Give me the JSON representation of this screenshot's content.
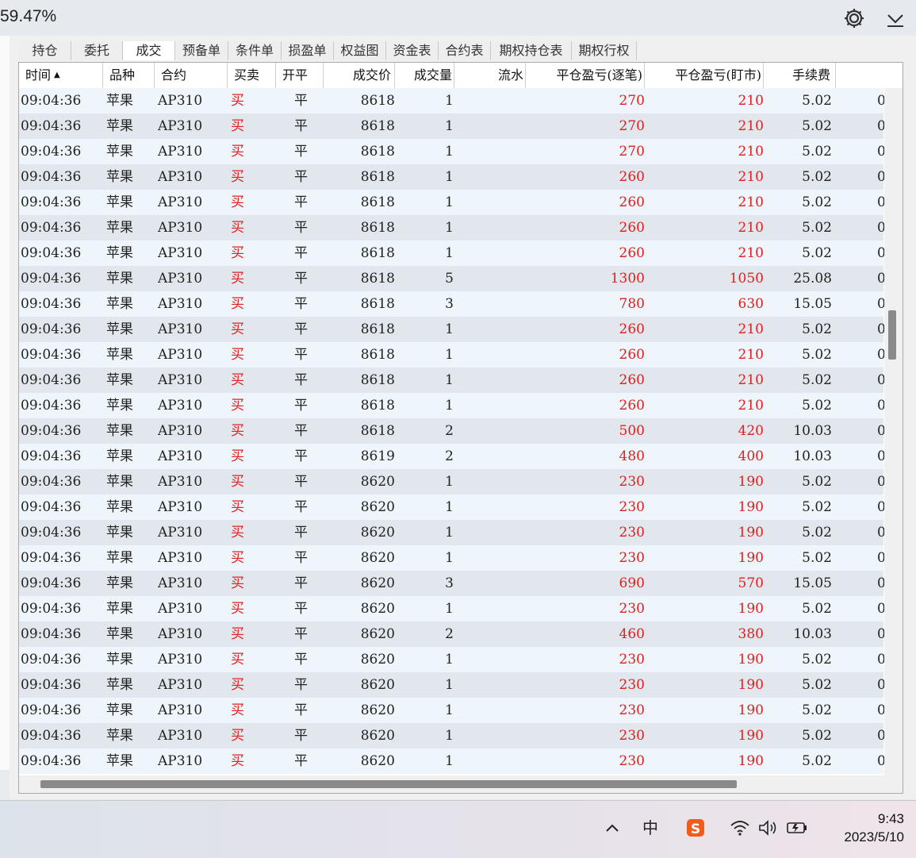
{
  "window": {
    "zoom_label": "59.47%"
  },
  "tabs": [
    "持仓",
    "委托",
    "成交",
    "预备单",
    "条件单",
    "损盈单",
    "权益图",
    "资金表",
    "合约表",
    "期权持仓表",
    "期权行权"
  ],
  "active_tab": "成交",
  "columns": [
    {
      "label": "时间",
      "sort": "▲"
    },
    {
      "label": "品种"
    },
    {
      "label": "合约"
    },
    {
      "label": "买卖"
    },
    {
      "label": "开平"
    },
    {
      "label": "成交价"
    },
    {
      "label": "成交量"
    },
    {
      "label": "流水"
    },
    {
      "label": "平仓盈亏(逐笔)"
    },
    {
      "label": "平仓盈亏(盯市)"
    },
    {
      "label": "手续费"
    }
  ],
  "rows": [
    [
      "09:04:36",
      "苹果",
      "AP310",
      "买",
      "平",
      "8618",
      "1",
      "",
      "270",
      "210",
      "5.02",
      "0"
    ],
    [
      "09:04:36",
      "苹果",
      "AP310",
      "买",
      "平",
      "8618",
      "1",
      "",
      "270",
      "210",
      "5.02",
      "0"
    ],
    [
      "09:04:36",
      "苹果",
      "AP310",
      "买",
      "平",
      "8618",
      "1",
      "",
      "270",
      "210",
      "5.02",
      "0"
    ],
    [
      "09:04:36",
      "苹果",
      "AP310",
      "买",
      "平",
      "8618",
      "1",
      "",
      "260",
      "210",
      "5.02",
      "0"
    ],
    [
      "09:04:36",
      "苹果",
      "AP310",
      "买",
      "平",
      "8618",
      "1",
      "",
      "260",
      "210",
      "5.02",
      "0"
    ],
    [
      "09:04:36",
      "苹果",
      "AP310",
      "买",
      "平",
      "8618",
      "1",
      "",
      "260",
      "210",
      "5.02",
      "0"
    ],
    [
      "09:04:36",
      "苹果",
      "AP310",
      "买",
      "平",
      "8618",
      "1",
      "",
      "260",
      "210",
      "5.02",
      "0"
    ],
    [
      "09:04:36",
      "苹果",
      "AP310",
      "买",
      "平",
      "8618",
      "5",
      "",
      "1300",
      "1050",
      "25.08",
      "0"
    ],
    [
      "09:04:36",
      "苹果",
      "AP310",
      "买",
      "平",
      "8618",
      "3",
      "",
      "780",
      "630",
      "15.05",
      "0"
    ],
    [
      "09:04:36",
      "苹果",
      "AP310",
      "买",
      "平",
      "8618",
      "1",
      "",
      "260",
      "210",
      "5.02",
      "0"
    ],
    [
      "09:04:36",
      "苹果",
      "AP310",
      "买",
      "平",
      "8618",
      "1",
      "",
      "260",
      "210",
      "5.02",
      "0"
    ],
    [
      "09:04:36",
      "苹果",
      "AP310",
      "买",
      "平",
      "8618",
      "1",
      "",
      "260",
      "210",
      "5.02",
      "0"
    ],
    [
      "09:04:36",
      "苹果",
      "AP310",
      "买",
      "平",
      "8618",
      "1",
      "",
      "260",
      "210",
      "5.02",
      "0"
    ],
    [
      "09:04:36",
      "苹果",
      "AP310",
      "买",
      "平",
      "8618",
      "2",
      "",
      "500",
      "420",
      "10.03",
      "0"
    ],
    [
      "09:04:36",
      "苹果",
      "AP310",
      "买",
      "平",
      "8619",
      "2",
      "",
      "480",
      "400",
      "10.03",
      "0"
    ],
    [
      "09:04:36",
      "苹果",
      "AP310",
      "买",
      "平",
      "8620",
      "1",
      "",
      "230",
      "190",
      "5.02",
      "0"
    ],
    [
      "09:04:36",
      "苹果",
      "AP310",
      "买",
      "平",
      "8620",
      "1",
      "",
      "230",
      "190",
      "5.02",
      "0"
    ],
    [
      "09:04:36",
      "苹果",
      "AP310",
      "买",
      "平",
      "8620",
      "1",
      "",
      "230",
      "190",
      "5.02",
      "0"
    ],
    [
      "09:04:36",
      "苹果",
      "AP310",
      "买",
      "平",
      "8620",
      "1",
      "",
      "230",
      "190",
      "5.02",
      "0"
    ],
    [
      "09:04:36",
      "苹果",
      "AP310",
      "买",
      "平",
      "8620",
      "3",
      "",
      "690",
      "570",
      "15.05",
      "0"
    ],
    [
      "09:04:36",
      "苹果",
      "AP310",
      "买",
      "平",
      "8620",
      "1",
      "",
      "230",
      "190",
      "5.02",
      "0"
    ],
    [
      "09:04:36",
      "苹果",
      "AP310",
      "买",
      "平",
      "8620",
      "2",
      "",
      "460",
      "380",
      "10.03",
      "0"
    ],
    [
      "09:04:36",
      "苹果",
      "AP310",
      "买",
      "平",
      "8620",
      "1",
      "",
      "230",
      "190",
      "5.02",
      "0"
    ],
    [
      "09:04:36",
      "苹果",
      "AP310",
      "买",
      "平",
      "8620",
      "1",
      "",
      "230",
      "190",
      "5.02",
      "0"
    ],
    [
      "09:04:36",
      "苹果",
      "AP310",
      "买",
      "平",
      "8620",
      "1",
      "",
      "230",
      "190",
      "5.02",
      "0"
    ],
    [
      "09:04:36",
      "苹果",
      "AP310",
      "买",
      "平",
      "8620",
      "1",
      "",
      "230",
      "190",
      "5.02",
      "0"
    ],
    [
      "09:04:36",
      "苹果",
      "AP310",
      "买",
      "平",
      "8620",
      "1",
      "",
      "230",
      "190",
      "5.02",
      "0"
    ]
  ],
  "colors": {
    "buy": "#e02020",
    "profit": "#e02020"
  },
  "taskbar": {
    "tray_icons": [
      "chevron-up-icon",
      "ime-zh-icon",
      "sogou-icon",
      "wifi-icon",
      "volume-icon",
      "battery-icon"
    ],
    "ime_label": "中",
    "time": "9:43",
    "date": "2023/5/10"
  }
}
